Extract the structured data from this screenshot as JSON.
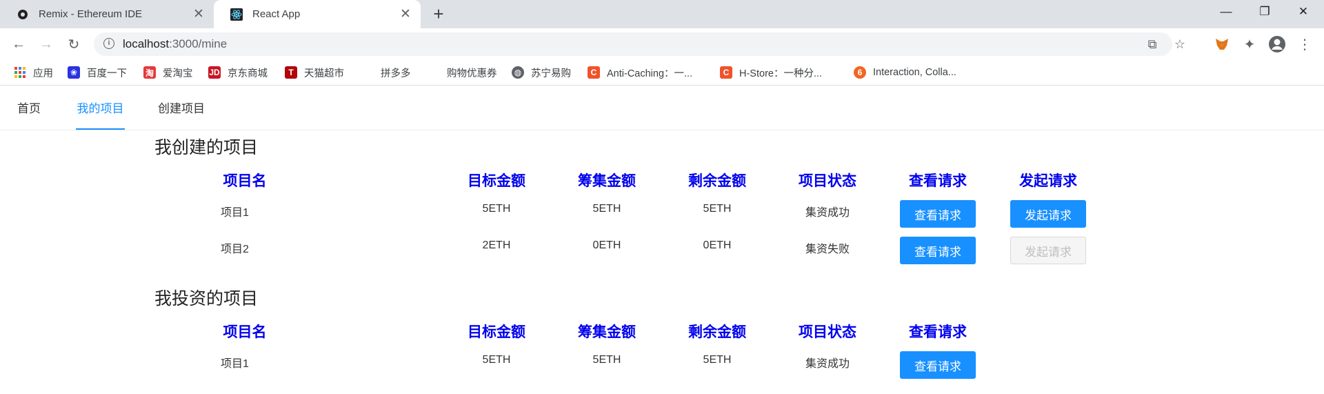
{
  "browser": {
    "tabs": [
      {
        "title": "Remix - Ethereum IDE",
        "icon": "remix-icon"
      },
      {
        "title": "React App",
        "icon": "react-icon",
        "active": true
      }
    ],
    "address": {
      "host": "localhost",
      "path": ":3000/mine"
    },
    "bookmarks": [
      {
        "label": "应用"
      },
      {
        "label": "百度一下"
      },
      {
        "label": "爱淘宝"
      },
      {
        "label": "京东商城"
      },
      {
        "label": "天猫超市"
      },
      {
        "label": "拼多多"
      },
      {
        "label": "购物优惠券"
      },
      {
        "label": "苏宁易购"
      },
      {
        "label": "Anti-Caching：一..."
      },
      {
        "label": "H-Store：一种分..."
      },
      {
        "label": "Interaction, Colla..."
      }
    ]
  },
  "nav": {
    "items": [
      {
        "label": "首页"
      },
      {
        "label": "我的项目",
        "active": true
      },
      {
        "label": "创建项目"
      }
    ]
  },
  "created": {
    "title": "我创建的项目",
    "headers": [
      "项目名",
      "目标金额",
      "筹集金额",
      "剩余金额",
      "项目状态",
      "查看请求",
      "发起请求"
    ],
    "rows": [
      {
        "name": "项目1",
        "target": "5ETH",
        "raised": "5ETH",
        "remaining": "5ETH",
        "status": "集资成功",
        "view": "查看请求",
        "initiate": "发起请求",
        "initiate_enabled": true
      },
      {
        "name": "项目2",
        "target": "2ETH",
        "raised": "0ETH",
        "remaining": "0ETH",
        "status": "集资失败",
        "view": "查看请求",
        "initiate": "发起请求",
        "initiate_enabled": false
      }
    ]
  },
  "invested": {
    "title": "我投资的项目",
    "headers": [
      "项目名",
      "目标金额",
      "筹集金额",
      "剩余金额",
      "项目状态",
      "查看请求"
    ],
    "rows": [
      {
        "name": "项目1",
        "target": "5ETH",
        "raised": "5ETH",
        "remaining": "5ETH",
        "status": "集资成功",
        "view": "查看请求"
      }
    ]
  },
  "colors": {
    "accent": "#1890ff",
    "header_text": "#0000ee",
    "disabled_bg": "#f5f5f5"
  }
}
